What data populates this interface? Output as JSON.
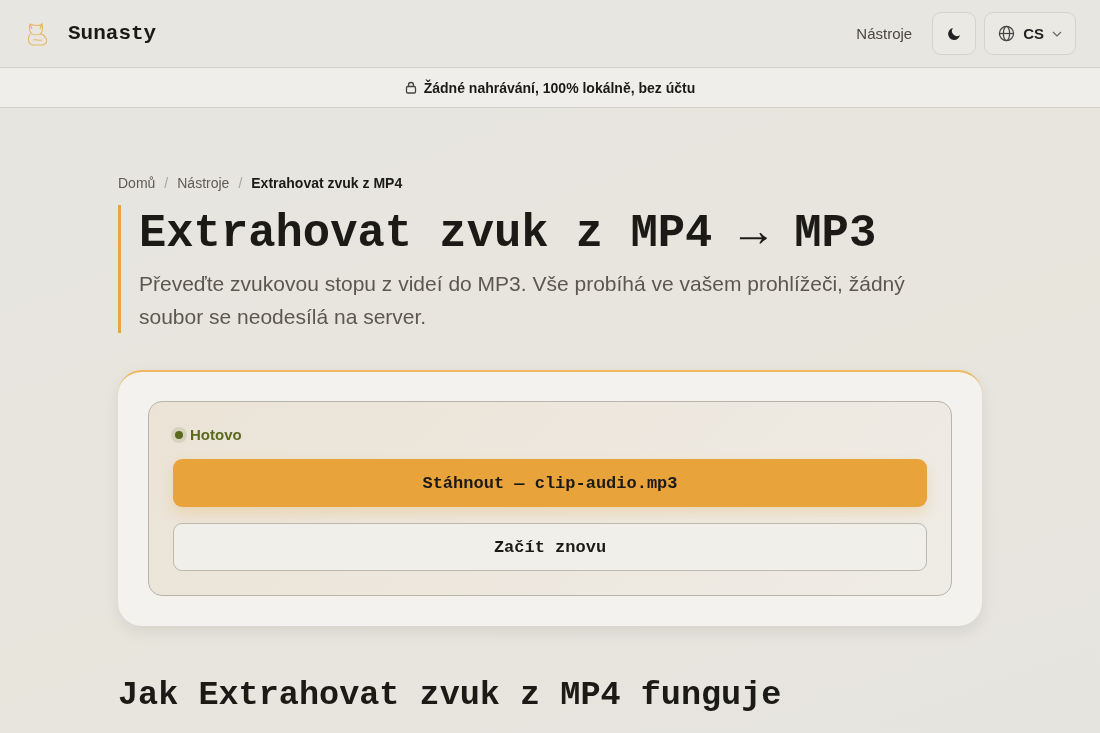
{
  "header": {
    "brand": "Sunasty",
    "nav_link": "Nástroje",
    "language": "CS"
  },
  "banner": {
    "text": "Žádné nahrávání, 100% lokálně, bez účtu"
  },
  "breadcrumb": [
    {
      "label": "Domů",
      "current": false
    },
    {
      "separator": "/",
      "label": "Nástroje",
      "current": false
    },
    {
      "separator": "/",
      "label": "Extrahovat zvuk z MP4",
      "current": true
    }
  ],
  "title": "Extrahovat zvuk z MP4 → MP3",
  "subtitle": "Převeďte zvukovou stopu z videí do MP3. Vše probíhá ve vašem prohlížeči, žádný soubor se neodesílá na server.",
  "result": {
    "status": {
      "label": "Hotovo",
      "color": "#5a6b1e"
    },
    "buttons": [
      {
        "label": "Stáhnout — clip-audio.mp3",
        "kind": "primary"
      },
      {
        "label": "Začít znovu",
        "kind": "secondary"
      }
    ]
  },
  "section_heading": "Jak Extrahovat zvuk z MP4 funguje"
}
